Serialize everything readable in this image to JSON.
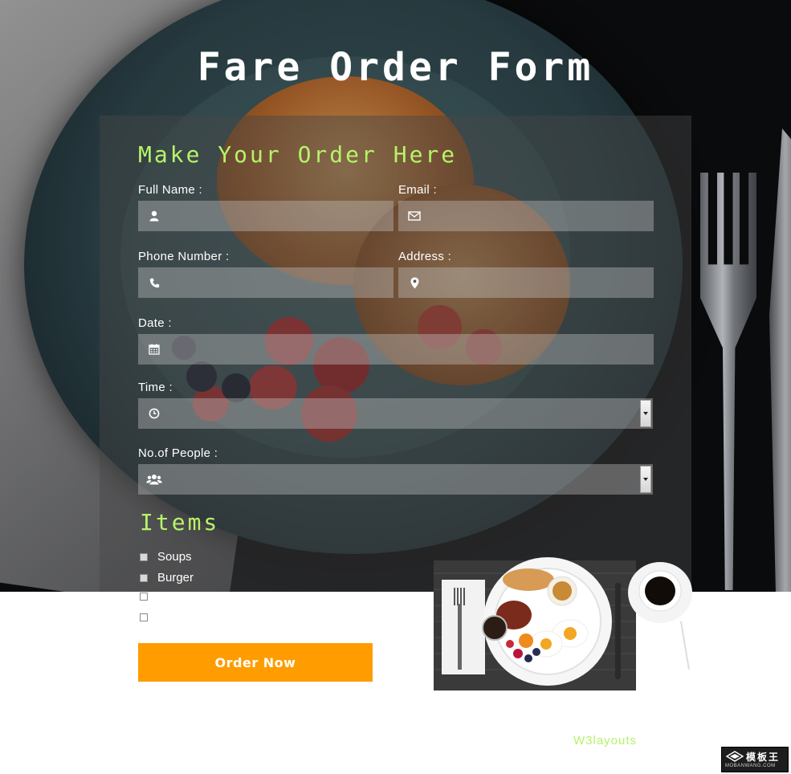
{
  "page": {
    "title": "Fare Order Form"
  },
  "form": {
    "heading": "Make Your Order Here",
    "fields": {
      "full_name": {
        "label": "Full Name :",
        "icon": "user-icon",
        "value": ""
      },
      "email": {
        "label": "Email :",
        "icon": "envelope-icon",
        "value": ""
      },
      "phone": {
        "label": "Phone Number :",
        "icon": "phone-icon",
        "value": ""
      },
      "address": {
        "label": "Address :",
        "icon": "map-marker-icon",
        "value": ""
      },
      "date": {
        "label": "Date :",
        "icon": "calendar-icon",
        "value": ""
      },
      "time": {
        "label": "Time :",
        "icon": "clock-icon",
        "selected": ""
      },
      "people": {
        "label": "No.of People :",
        "icon": "users-icon",
        "selected": ""
      }
    },
    "items_heading": "Items",
    "items": [
      {
        "label": "Soups",
        "checked": false
      },
      {
        "label": "Burger",
        "checked": false
      },
      {
        "label": "",
        "checked": false
      },
      {
        "label": "",
        "checked": false
      }
    ],
    "submit_label": "Order Now"
  },
  "footer": {
    "credit": "W3layouts",
    "watermark_top": "模板王",
    "watermark_bottom": "MOBANWANG.COM"
  },
  "colors": {
    "accent_green": "#b6f36a",
    "button_orange": "#ff9c00",
    "title_white": "#ffffff"
  }
}
